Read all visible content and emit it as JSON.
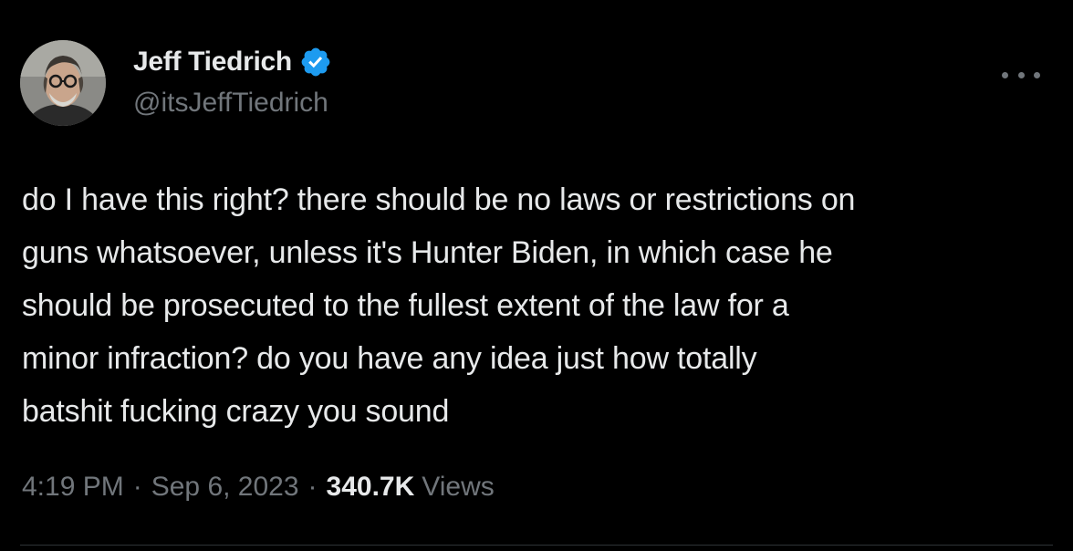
{
  "author": {
    "display_name": "Jeff Tiedrich",
    "handle": "@itsJeffTiedrich",
    "verified_icon": "verified-badge-icon",
    "avatar_icon": "profile-photo"
  },
  "menu": {
    "icon": "more-horizontal-icon"
  },
  "tweet": {
    "lines": [
      "do I have this right? there should be no laws or restrictions on",
      "guns whatsoever, unless it's Hunter Biden, in which case he",
      "should be prosecuted to the fullest extent of the law for a",
      "minor infraction? do you have any idea just how totally",
      "batshit fucking crazy you sound"
    ]
  },
  "meta": {
    "time": "4:19 PM",
    "separator": "·",
    "date": "Sep 6, 2023",
    "views_count": "340.7K",
    "views_label": "Views"
  },
  "colors": {
    "background": "#000000",
    "primary_text": "#e7e9ea",
    "secondary_text": "#71767b",
    "verified_blue": "#1d9bf0",
    "divider": "#2f3336"
  }
}
